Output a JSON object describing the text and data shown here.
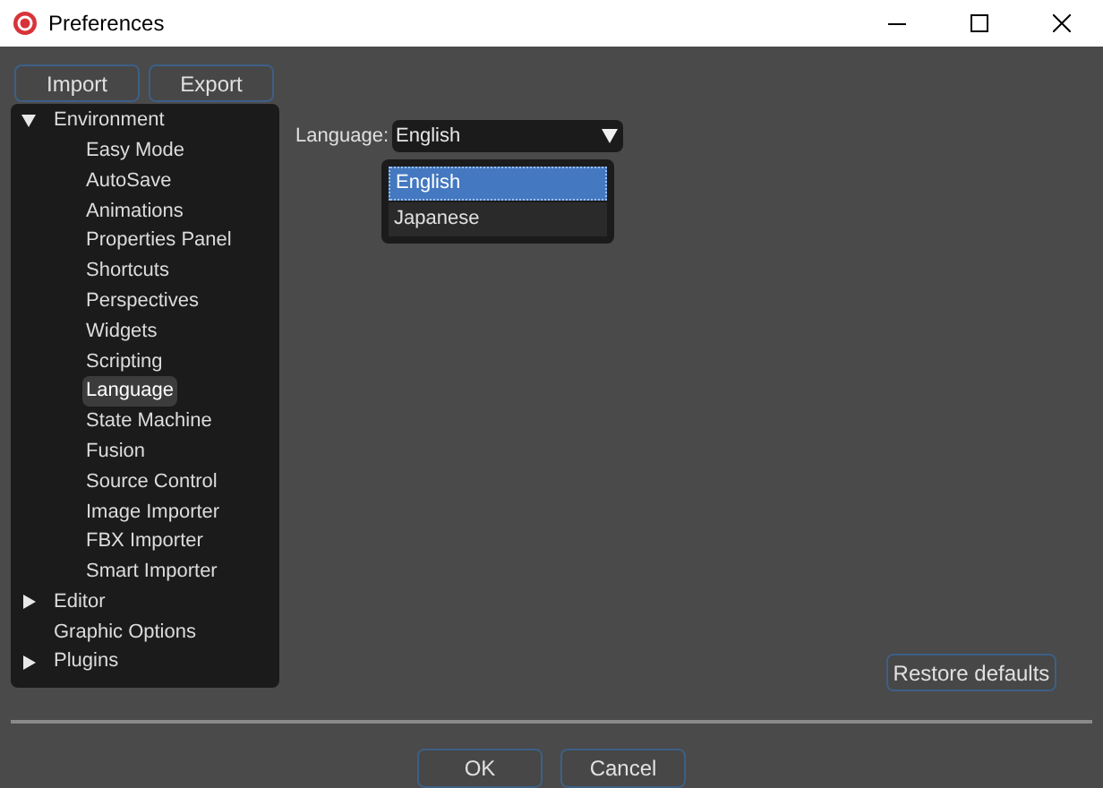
{
  "window": {
    "title": "Preferences"
  },
  "toolbar": {
    "buttons": [
      "Import",
      "Export"
    ]
  },
  "tree": [
    {
      "label": "Environment",
      "expanded": true,
      "selected": false,
      "children": [
        {
          "label": "Easy Mode",
          "selected": false
        },
        {
          "label": "AutoSave",
          "selected": false
        },
        {
          "label": "Animations",
          "selected": false
        },
        {
          "label": "Properties Panel",
          "selected": false
        },
        {
          "label": "Shortcuts",
          "selected": false
        },
        {
          "label": "Perspectives",
          "selected": false
        },
        {
          "label": "Widgets",
          "selected": false
        },
        {
          "label": "Scripting",
          "selected": false
        },
        {
          "label": "Language",
          "selected": true
        },
        {
          "label": "State Machine",
          "selected": false
        },
        {
          "label": "Fusion",
          "selected": false
        },
        {
          "label": "Source Control",
          "selected": false
        },
        {
          "label": "Image Importer",
          "selected": false
        },
        {
          "label": "FBX Importer",
          "selected": false
        },
        {
          "label": "Smart Importer",
          "selected": false
        }
      ]
    },
    {
      "label": "Editor",
      "expandable": true,
      "expanded": false,
      "selected": false
    },
    {
      "label": "Graphic Options",
      "selected": false
    },
    {
      "label": "Plugins",
      "expandable": true,
      "expanded": false,
      "selected": false
    }
  ],
  "language": {
    "label": "Language:",
    "value": "English",
    "expanded": true,
    "options": [
      {
        "label": "English",
        "selected": true
      },
      {
        "label": "Japanese",
        "selected": false
      }
    ]
  },
  "restore_button": "Restore defaults",
  "footer": {
    "buttons": [
      "OK",
      "Cancel"
    ]
  }
}
